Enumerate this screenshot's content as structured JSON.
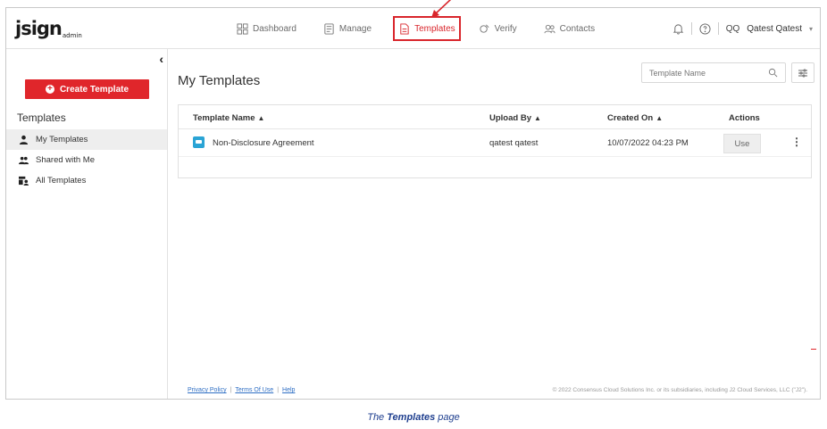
{
  "app": {
    "logo_text": "jsign",
    "logo_sub": "admin"
  },
  "nav": {
    "items": [
      {
        "label": "Dashboard",
        "icon": "dashboard-icon",
        "active": false
      },
      {
        "label": "Manage",
        "icon": "manage-icon",
        "active": false
      },
      {
        "label": "Templates",
        "icon": "templates-icon",
        "active": true
      },
      {
        "label": "Verify",
        "icon": "verify-icon",
        "active": false
      },
      {
        "label": "Contacts",
        "icon": "contacts-icon",
        "active": false
      }
    ],
    "active_color": "#d9262c"
  },
  "user": {
    "initials": "QQ",
    "name": "Qatest Qatest"
  },
  "sidebar": {
    "create_label": "Create Template",
    "heading": "Templates",
    "items": [
      {
        "label": "My Templates",
        "icon": "person-icon",
        "selected": true
      },
      {
        "label": "Shared with Me",
        "icon": "people-icon",
        "selected": false
      },
      {
        "label": "All Templates",
        "icon": "group-icon",
        "selected": false
      }
    ]
  },
  "main": {
    "title": "My Templates",
    "search_placeholder": "Template Name",
    "table": {
      "columns": [
        "Template Name",
        "Upload By",
        "Created On",
        "Actions"
      ],
      "rows": [
        {
          "name": "Non-Disclosure Agreement",
          "upload_by": "qatest qatest",
          "created_on": "10/07/2022 04:23 PM",
          "action": "Use"
        }
      ]
    }
  },
  "footer": {
    "links": [
      "Privacy Policy",
      "Terms Of Use",
      "Help"
    ],
    "copyright": "© 2022 Consensus Cloud Solutions Inc. or its subsidiaries, including J2 Cloud Services, LLC (\"J2\")."
  },
  "caption": {
    "prefix": "The ",
    "bold": "Templates",
    "suffix": " page"
  },
  "colors": {
    "accent": "#e0262b",
    "link": "#2f6fc4",
    "caption": "#1f3f8f"
  }
}
